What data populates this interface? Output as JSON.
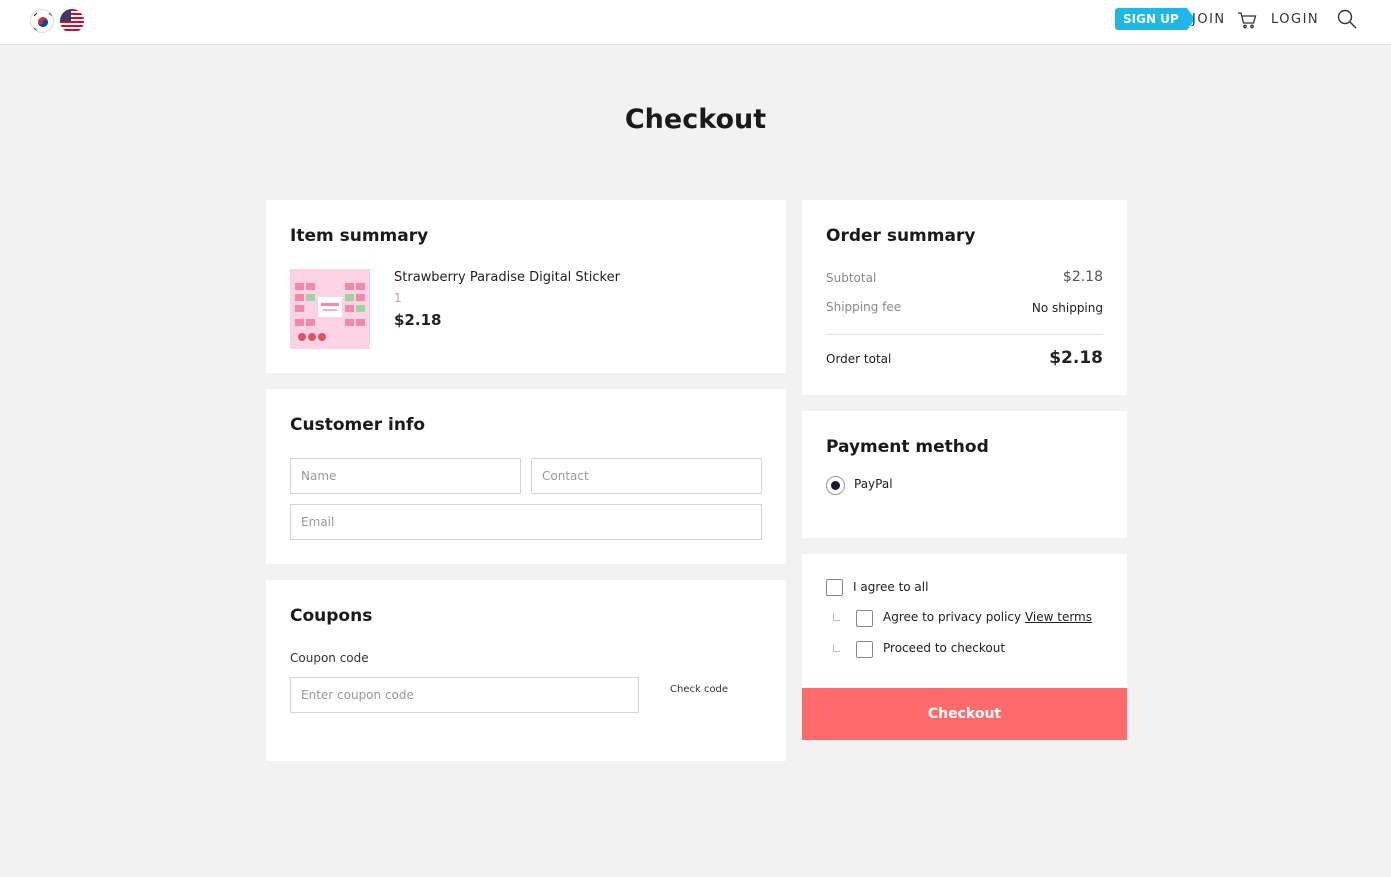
{
  "header": {
    "signup_badge": "SIGN UP",
    "join": "JOIN",
    "login": "LOGIN",
    "languages": [
      "korean-flag-icon",
      "us-flag-icon"
    ]
  },
  "page_title": "Checkout",
  "item_summary": {
    "title": "Item summary",
    "item": {
      "name": "Strawberry Paradise Digital Sticker",
      "quantity": "1",
      "price": "$2.18"
    }
  },
  "customer_info": {
    "title": "Customer info",
    "name_placeholder": "Name",
    "contact_placeholder": "Contact",
    "email_placeholder": "Email"
  },
  "coupons": {
    "title": "Coupons",
    "label": "Coupon code",
    "placeholder": "Enter coupon code",
    "check_button": "Check code"
  },
  "order_summary": {
    "title": "Order summary",
    "subtotal_label": "Subtotal",
    "subtotal_value": "$2.18",
    "shipping_label": "Shipping fee",
    "shipping_value": "No shipping",
    "total_label": "Order total",
    "total_value": "$2.18"
  },
  "payment": {
    "title": "Payment method",
    "selected": "PayPal"
  },
  "agreements": {
    "agree_all": "I agree to all",
    "privacy": "Agree to privacy policy",
    "view_terms": "View terms",
    "proceed": "Proceed to checkout"
  },
  "checkout_button": "Checkout",
  "colors": {
    "accent": "#ff6b6b",
    "signup": "#1fb6e8",
    "background": "#f2f2f2"
  }
}
